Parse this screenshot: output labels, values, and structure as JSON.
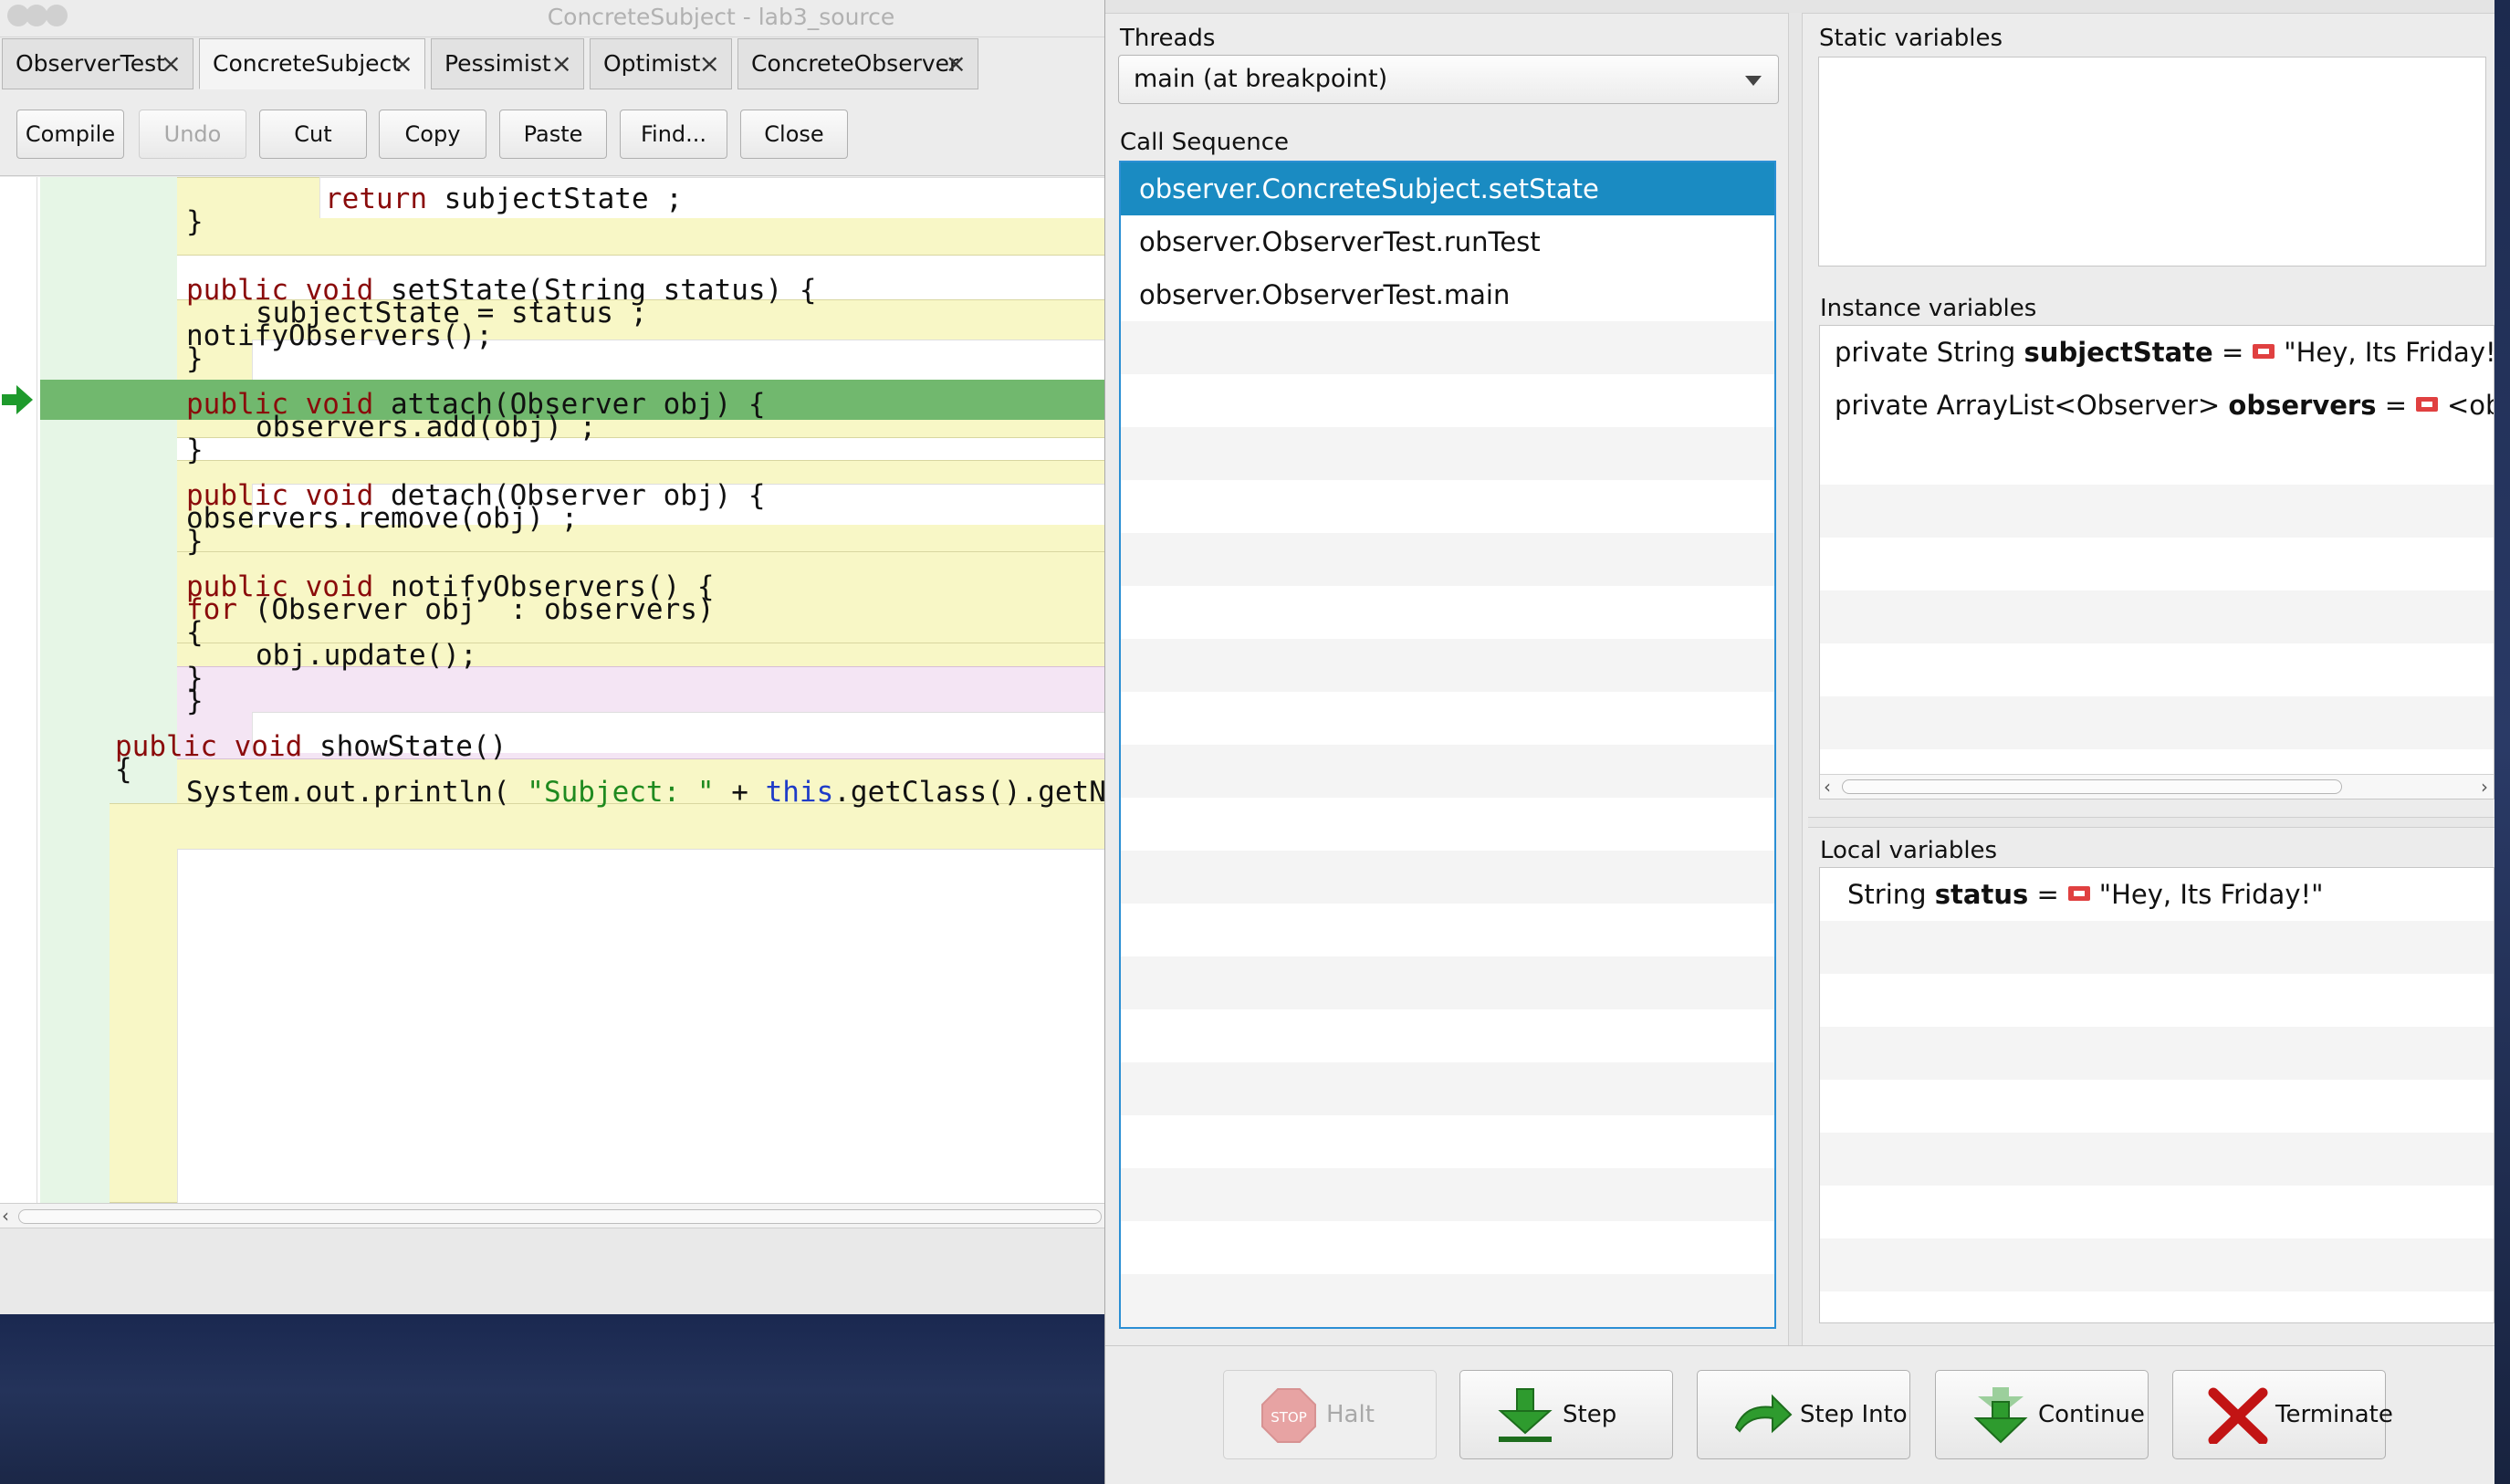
{
  "editor": {
    "window_title": "ConcreteSubject - lab3_source",
    "tabs": [
      {
        "label": "ObserverTest"
      },
      {
        "label": "ConcreteSubject"
      },
      {
        "label": "Pessimist"
      },
      {
        "label": "Optimist"
      },
      {
        "label": "ConcreteObserver"
      }
    ],
    "active_tab": "ConcreteSubject",
    "toolbar": {
      "compile": "Compile",
      "undo": "Undo",
      "cut": "Cut",
      "copy": "Copy",
      "paste": "Paste",
      "find": "Find...",
      "close": "Close"
    },
    "code_lines": [
      "return subjectState ;",
      "}",
      "public void setState(String status) {",
      "subjectState = status ;",
      "notifyObservers();",
      "}",
      "public void attach(Observer obj) {",
      "observers.add(obj) ;",
      "}",
      "public void detach(Observer obj) {",
      "observers.remove(obj) ;",
      "}",
      "public void notifyObservers() {",
      "for (Observer obj  : observers)",
      "{",
      "obj.update();",
      "}",
      "}",
      "public void showState()",
      "{",
      "System.out.println( \"Subject: \" + this.getClass().getN"
    ],
    "current_line_index": 4
  },
  "debugger": {
    "threads_label": "Threads",
    "thread_selected": "main (at breakpoint)",
    "call_sequence_label": "Call Sequence",
    "call_sequence": [
      "observer.ConcreteSubject.setState",
      "observer.ObserverTest.runTest",
      "observer.ObserverTest.main"
    ],
    "selected_call_index": 0,
    "static_label": "Static variables",
    "instance_label": "Instance variables",
    "instance_vars": [
      {
        "prefix": "private String",
        "name": "subjectState",
        "eq": "=",
        "value": "\"Hey, Its Friday!\""
      },
      {
        "prefix": "private ArrayList<Observer>",
        "name": "observers",
        "eq": "=",
        "value": "<object"
      }
    ],
    "local_label": "Local variables",
    "local_vars": [
      {
        "prefix": "String",
        "name": "status",
        "eq": "=",
        "value": "\"Hey, Its Friday!\""
      }
    ],
    "buttons": {
      "halt": "Halt",
      "halt_icon_text": "STOP",
      "step": "Step",
      "step_into": "Step Into",
      "continue": "Continue",
      "terminate": "Terminate"
    }
  },
  "colors": {
    "selection": "#1a8bc2",
    "execution_line": "#71b86e",
    "keyword": "#8a0b0b",
    "yellow_scope": "#f8f7c6",
    "pink_scope": "#f4e5f4"
  }
}
